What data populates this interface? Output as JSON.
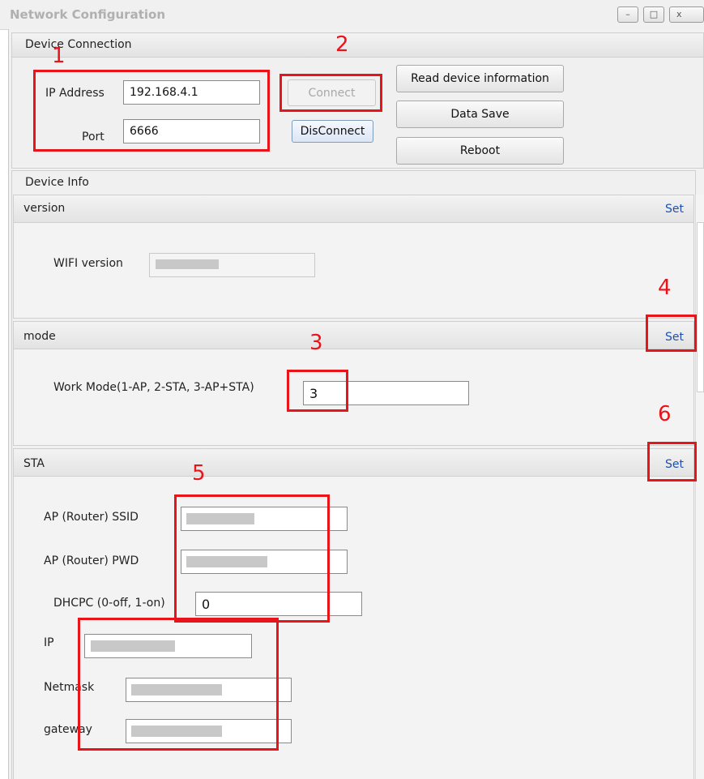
{
  "window": {
    "title": "Network Configuration",
    "controls": {
      "minimize": "–",
      "maximize": "□",
      "close": "x"
    }
  },
  "connection": {
    "title": "Device Connection",
    "ip_label": "IP Address",
    "ip_value": "192.168.4.1",
    "port_label": "Port",
    "port_value": "6666",
    "connect_label": "Connect",
    "disconnect_label": "DisConnect",
    "read_label": "Read  device information",
    "save_label": "Data Save",
    "reboot_label": "Reboot"
  },
  "device_info": {
    "title": "Device Info",
    "version": {
      "title": "version",
      "set_label": "Set",
      "wifi_label": "WIFI version",
      "wifi_value": ""
    },
    "mode": {
      "title": "mode",
      "set_label": "Set",
      "work_label": "Work Mode(1-AP, 2-STA, 3-AP+STA)",
      "work_value": "3"
    },
    "sta": {
      "title": "STA",
      "set_label": "Set",
      "ssid_label": "AP (Router) SSID",
      "ssid_value": "",
      "pwd_label": "AP (Router) PWD",
      "pwd_value": "",
      "dhcp_label": "DHCPC (0-off, 1-on)",
      "dhcp_value": "0",
      "ip_label": "IP",
      "ip_value": "",
      "netmask_label": "Netmask",
      "netmask_value": "",
      "gateway_label": "gateway",
      "gateway_value": ""
    }
  },
  "annotations": {
    "n1": "1",
    "n2": "2",
    "n3": "3",
    "n4": "4",
    "n5": "5",
    "n6": "6"
  }
}
